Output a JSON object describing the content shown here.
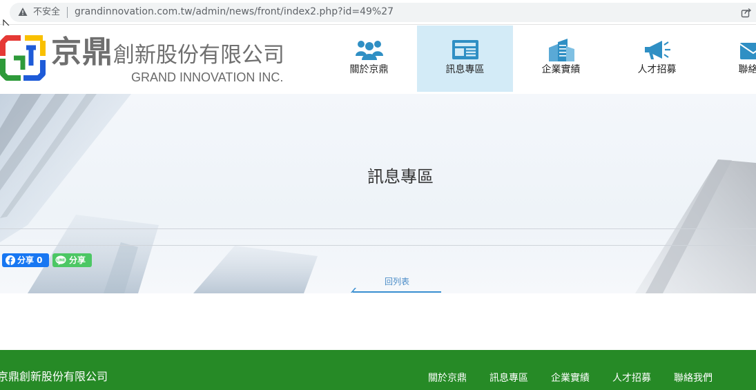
{
  "browser": {
    "security_label": "不安全",
    "url": "grandinnovation.com.tw/admin/news/front/index2.php?id=49%27"
  },
  "logo": {
    "name_main": "京鼎",
    "name_rest": "創新股份有限公司",
    "name_en": "GRAND INNOVATION INC.",
    "mark_colors": [
      "#e53935",
      "#f9c000",
      "#2e9a3a",
      "#1e5bd8"
    ]
  },
  "nav": {
    "items": [
      {
        "label": "關於京鼎",
        "icon": "team-icon",
        "active": false
      },
      {
        "label": "訊息專區",
        "icon": "news-icon",
        "active": true
      },
      {
        "label": "企業實績",
        "icon": "buildings-icon",
        "active": false
      },
      {
        "label": "人才招募",
        "icon": "megaphone-icon",
        "active": false
      },
      {
        "label": "聯絡我",
        "icon": "mail-icon",
        "active": false
      }
    ],
    "icon_color": "#2f8fc4",
    "active_bg": "#d3ebf7"
  },
  "banner": {
    "title": "訊息專區",
    "fb_share_label": "分享 0",
    "line_share_label": "分享",
    "back_link": "回列表"
  },
  "footer": {
    "company": "京鼎創新股份有限公司",
    "links": [
      "關於京鼎",
      "訊息專區",
      "企業實績",
      "人才招募",
      "聯絡我們"
    ],
    "bg_color": "#268a26"
  }
}
